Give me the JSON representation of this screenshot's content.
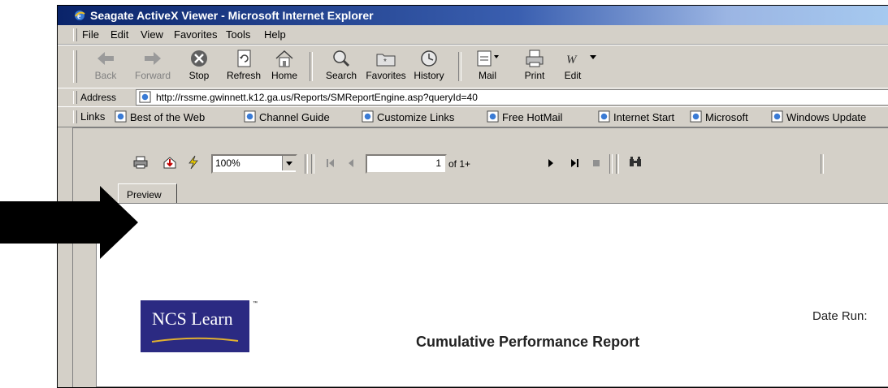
{
  "window": {
    "title": "Seagate ActiveX Viewer - Microsoft Internet Explorer"
  },
  "menu": [
    "File",
    "Edit",
    "View",
    "Favorites",
    "Tools",
    "Help"
  ],
  "toolbar": {
    "buttons": [
      {
        "label": "Back",
        "icon": "back-arrow-icon",
        "enabled": false
      },
      {
        "label": "Forward",
        "icon": "forward-arrow-icon",
        "enabled": false
      },
      {
        "label": "Stop",
        "icon": "stop-icon",
        "enabled": true
      },
      {
        "label": "Refresh",
        "icon": "refresh-icon",
        "enabled": true
      },
      {
        "label": "Home",
        "icon": "home-icon",
        "enabled": true
      },
      {
        "label": "Search",
        "icon": "search-icon",
        "enabled": true
      },
      {
        "label": "Favorites",
        "icon": "favorites-icon",
        "enabled": true
      },
      {
        "label": "History",
        "icon": "history-icon",
        "enabled": true
      },
      {
        "label": "Mail",
        "icon": "mail-icon",
        "enabled": true
      },
      {
        "label": "Print",
        "icon": "print-icon",
        "enabled": true
      },
      {
        "label": "Edit",
        "icon": "edit-icon",
        "enabled": true
      }
    ]
  },
  "address": {
    "label": "Address",
    "url": "http://rssme.gwinnett.k12.ga.us/Reports/SMReportEngine.asp?queryId=40"
  },
  "links": {
    "label": "Links",
    "items": [
      "Best of the Web",
      "Channel Guide",
      "Customize Links",
      "Free HotMail",
      "Internet Start",
      "Microsoft",
      "Windows Update"
    ]
  },
  "viewer": {
    "zoom": "100%",
    "page_number": "1",
    "page_total": "of 1+",
    "tab_label": "Preview"
  },
  "report": {
    "logo_text": "NCS Learn",
    "logo_tm": "™",
    "title": "Cumulative Performance Report",
    "date_run_label": "Date Run:"
  },
  "colors": {
    "title_gradient_start": "#0a246a",
    "title_gradient_end": "#a6caf0",
    "chrome": "#d4d0c8",
    "logo_bg": "#2b2a82"
  }
}
